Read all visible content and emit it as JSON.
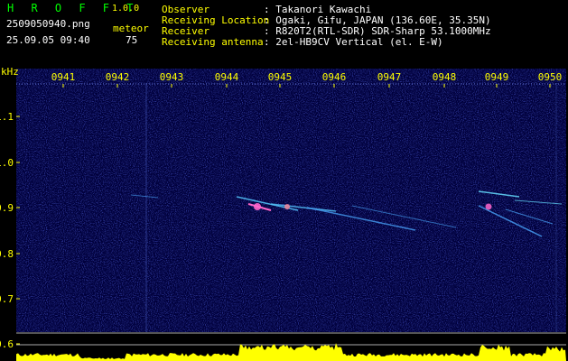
{
  "header": {
    "app_title": "H R O F F T",
    "version": "1.0.0",
    "filename": "2509050940.png",
    "datetime": "25.09.05 09:40",
    "meteor_label": "meteor",
    "meteor_count": "75"
  },
  "info": {
    "labels": [
      "Observer",
      "Receiving Location",
      "Receiver",
      "Receiving antenna"
    ],
    "values": [
      ": Takanori Kawachi",
      ": Ogaki, Gifu, JAPAN (136.60E, 35.35N)",
      ": R820T2(RTL-SDR) SDR-Sharp 53.1000MHz",
      ": 2el-HB9CV Vertical (el. E-W)"
    ]
  },
  "spectrogram": {
    "unit_label": "kHz",
    "time_ticks": [
      "0941",
      "0942",
      "0943",
      "0944",
      "0945",
      "0946",
      "0947",
      "0948",
      "0949",
      "0950"
    ],
    "freq_ticks": [
      "1.1",
      "1.0",
      "0.9",
      "0.8",
      "0.7",
      "0.6"
    ],
    "colors": {
      "background": "#00003c",
      "tick_text": "#ffff00",
      "label_text": "#00ff00",
      "info_text": "#ffffff",
      "carrier": "#33ffaa",
      "level": "#ffff00"
    }
  }
}
